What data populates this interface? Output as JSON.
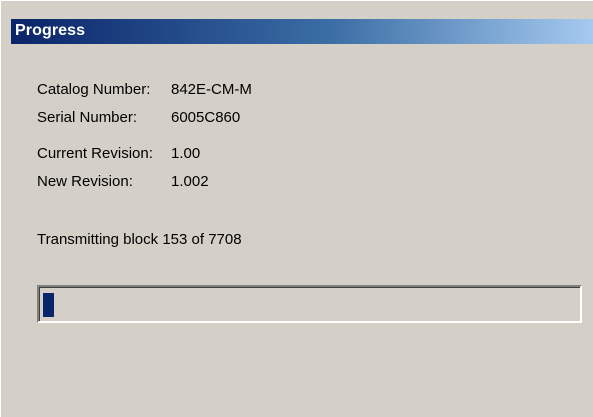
{
  "window": {
    "title": "Progress"
  },
  "fields": [
    {
      "label": "Catalog Number:",
      "value": "842E-CM-M"
    },
    {
      "label": "Serial Number:",
      "value": "6005C860"
    },
    {
      "label": "Current Revision:",
      "value": "1.00"
    },
    {
      "label": "New Revision:",
      "value": "1.002"
    }
  ],
  "status": {
    "text": "Transmitting  block 153 of 7708"
  },
  "progress": {
    "fraction": 0.0198,
    "color": "#0a246a"
  },
  "colors": {
    "background": "#d4d0c8",
    "title_gradient_start": "#0a246a",
    "title_gradient_end": "#a6caf0",
    "title_text": "#ffffff",
    "text": "#000000"
  }
}
